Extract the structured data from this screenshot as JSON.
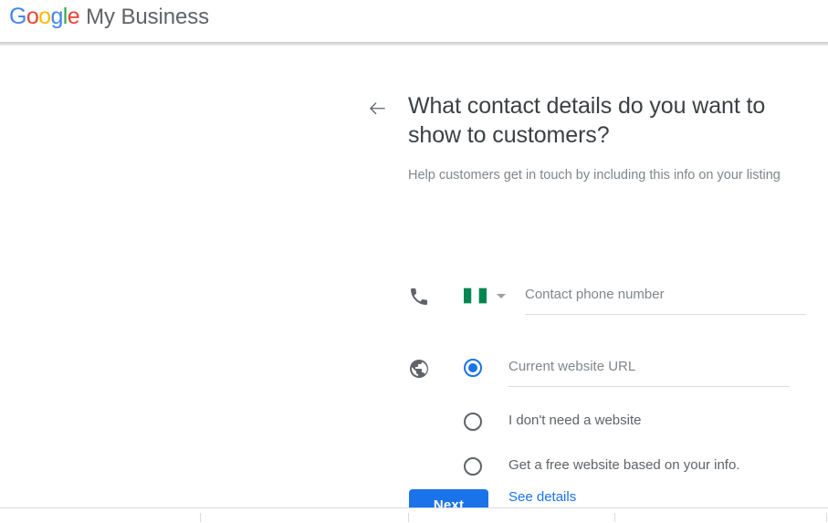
{
  "header": {
    "logo_word": "Google",
    "logo_letters": [
      "G",
      "o",
      "o",
      "g",
      "l",
      "e"
    ],
    "brand_suffix": "My Business",
    "colors": {
      "blue": "#4285f4",
      "red": "#ea4335",
      "yellow": "#fbbc05",
      "green": "#34a853",
      "suffix_gray": "#5f6368"
    }
  },
  "main": {
    "back_icon": "arrow-left-icon",
    "title": "What contact details do you want to show to customers?",
    "subtitle": "Help customers get in touch by including this info on your listing",
    "phone": {
      "icon": "phone-icon",
      "flag": "nigeria-flag-icon",
      "flag_colors": [
        "#008751",
        "#ffffff",
        "#008751"
      ],
      "dropdown_icon": "chevron-down-icon",
      "placeholder": "Contact phone number",
      "value": ""
    },
    "website": {
      "icon": "globe-icon",
      "selected_index": 0,
      "options": [
        {
          "label": "",
          "placeholder": "Current website URL",
          "value": "",
          "type": "input",
          "selected": true
        },
        {
          "label": "I don't need a website",
          "type": "label",
          "selected": false
        },
        {
          "label": "Get a free website based on your info.",
          "type": "label",
          "selected": false
        }
      ],
      "see_details_link": "See details"
    }
  },
  "actions": {
    "next_label": "Next",
    "next_color": "#1a73e8"
  },
  "bottom_bar": {
    "tick_positions": [
      219,
      447,
      673,
      905
    ]
  }
}
